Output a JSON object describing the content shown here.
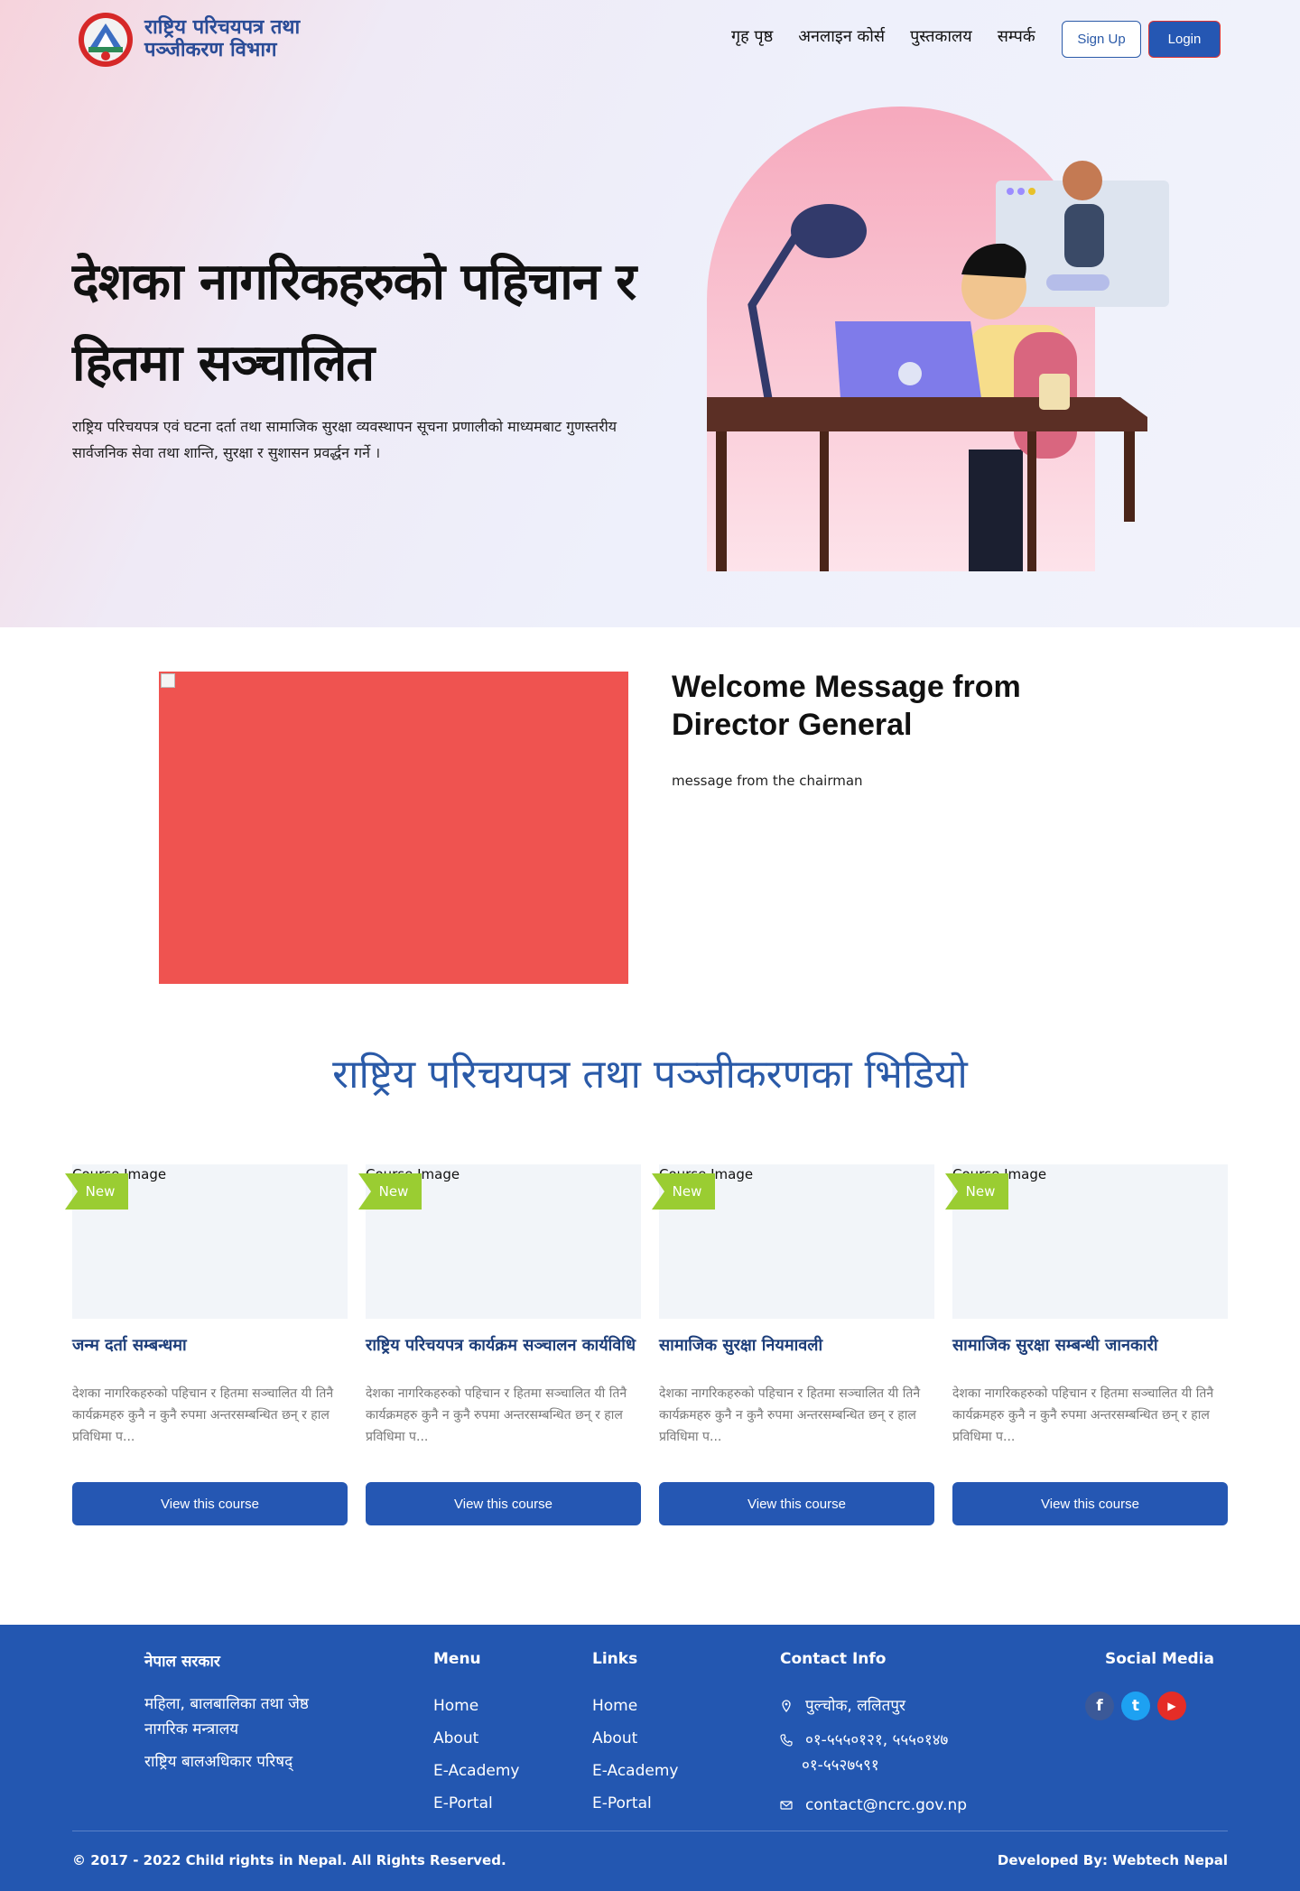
{
  "nav": {
    "brand": "राष्ट्रिय परिचयपत्र तथा पञ्जीकरण विभाग",
    "menu": [
      "गृह पृष्ठ",
      "अनलाइन कोर्स",
      "पुस्तकालय",
      "सम्पर्क"
    ],
    "signup_label": "Sign Up",
    "login_label": "Login"
  },
  "hero": {
    "title": "देशका नागरिकहरुको पहिचान र हितमा सञ्चालित",
    "subtitle": "राष्ट्रिय परिचयपत्र एवं घटना दर्ता तथा सामाजिक सुरक्षा व्यवस्थापन सूचना प्रणालीको माध्यमबाट गुणस्तरीय सार्वजनिक सेवा तथा शान्ति, सुरक्षा र सुशासन प्रवर्द्धन गर्ने ।"
  },
  "welcome": {
    "title": "Welcome Message from Director General",
    "text": "message from the chairman"
  },
  "videos": {
    "title": "राष्ट्रिय परिचयपत्र तथा पञ्जीकरणका भिडियो",
    "cards": [
      {
        "image_alt": "Course Image",
        "badge": "New",
        "title": "जन्म दर्ता सम्बन्धमा",
        "description": "देशका नागरिकहरुको पहिचान र हितमा सञ्चालित यी तिनै कार्यक्रमहरु कुनै न कुनै रुपमा अन्तरसम्बन्धित छन् र हाल प्रविधिमा प...",
        "button": "View this course"
      },
      {
        "image_alt": "Course Image",
        "badge": "New",
        "title": "राष्ट्रिय परिचयपत्र कार्यक्रम सञ्चालन कार्यविधि",
        "description": "देशका नागरिकहरुको पहिचान र हितमा सञ्चालित यी तिनै कार्यक्रमहरु कुनै न कुनै रुपमा अन्तरसम्बन्धित छन् र हाल प्रविधिमा प...",
        "button": "View this course"
      },
      {
        "image_alt": "Course Image",
        "badge": "New",
        "title": "सामाजिक सुरक्षा नियमावली",
        "description": "देशका नागरिकहरुको पहिचान र हितमा सञ्चालित यी तिनै कार्यक्रमहरु कुनै न कुनै रुपमा अन्तरसम्बन्धित छन् र हाल प्रविधिमा प...",
        "button": "View this course"
      },
      {
        "image_alt": "Course Image",
        "badge": "New",
        "title": "सामाजिक सुरक्षा सम्बन्धी जानकारी",
        "description": "देशका नागरिकहरुको पहिचान र हितमा सञ्चालित यी तिनै कार्यक्रमहरु कुनै न कुनै रुपमा अन्तरसम्बन्धित छन् र हाल प्रविधिमा प...",
        "button": "View this course"
      }
    ]
  },
  "footer": {
    "gov_title": "नेपाल सरकार",
    "gov_line1": "महिला, बालबालिका तथा जेष्ठ नागरिक मन्त्रालय",
    "gov_line2": "राष्ट्रिय बालअधिकार परिषद्",
    "menu_title": "Menu",
    "menu_items": [
      "Home",
      "About",
      "E-Academy",
      "E-Portal"
    ],
    "links_title": "Links",
    "links_items": [
      "Home",
      "About",
      "E-Academy",
      "E-Portal"
    ],
    "contact_title": "Contact Info",
    "address": "पुल्चोक, ललितपुर",
    "phone1": "०१-५५५०१२१, ५५५०१४७",
    "phone2": "०१-५५२७५९१",
    "email": "contact@ncrc.gov.np",
    "social_title": "Social Media",
    "socials": [
      {
        "icon": "facebook-icon",
        "glyph": "f",
        "color": "#3b5998"
      },
      {
        "icon": "twitter-icon",
        "glyph": "t",
        "color": "#1da1f2"
      },
      {
        "icon": "youtube-icon",
        "glyph": "▶",
        "color": "#e52d27"
      }
    ],
    "copyright": "© 2017 - 2022 Child rights in Nepal. All Rights Reserved.",
    "developer": "Developed By: Webtech Nepal"
  },
  "colors": {
    "primary": "#2557b3",
    "badge": "#9acd32",
    "welcome_image_bg": "#ef5350",
    "footer_bg": "#2357b1"
  }
}
